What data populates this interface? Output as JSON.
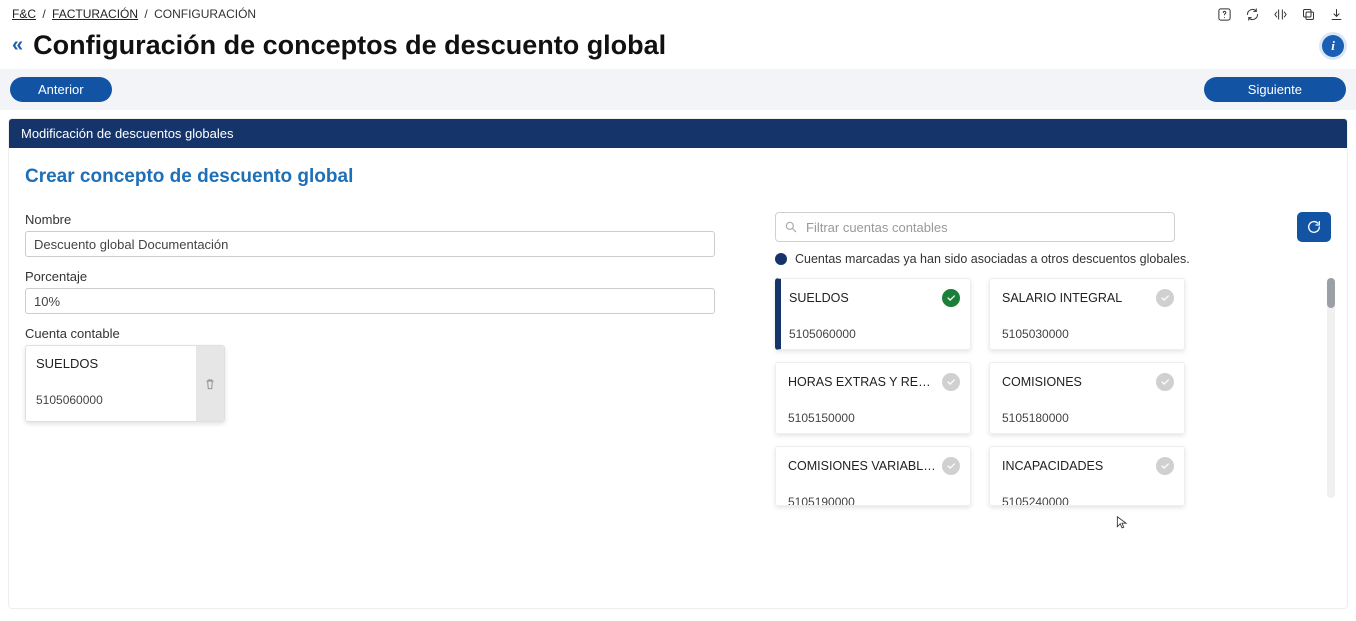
{
  "breadcrumb": {
    "root": "F&C",
    "lvl1": "FACTURACIÓN",
    "lvl2": "CONFIGURACIÓN"
  },
  "page": {
    "title": "Configuración de conceptos de descuento global",
    "prev": "Anterior",
    "next": "Siguiente",
    "panel_header": "Modificación de descuentos globales",
    "section_title": "Crear concepto de descuento global"
  },
  "form": {
    "name_label": "Nombre",
    "name_value": "Descuento global Documentación",
    "pct_label": "Porcentaje",
    "pct_value": "10%",
    "account_label": "Cuenta contable"
  },
  "selected_account": {
    "name": "SUELDOS",
    "code": "5105060000"
  },
  "search": {
    "placeholder": "Filtrar cuentas contables"
  },
  "note": "Cuentas marcadas ya han sido asociadas a otros descuentos globales.",
  "accounts": [
    {
      "name": "SUELDOS",
      "code": "5105060000",
      "selected": true
    },
    {
      "name": "SALARIO INTEGRAL",
      "code": "5105030000",
      "selected": false
    },
    {
      "name": "HORAS EXTRAS Y RECARGO",
      "code": "5105150000",
      "selected": false
    },
    {
      "name": "COMISIONES",
      "code": "5105180000",
      "selected": false
    },
    {
      "name": "COMISIONES VARIABLES",
      "code": "5105190000",
      "selected": false
    },
    {
      "name": "INCAPACIDADES",
      "code": "5105240000",
      "selected": false
    }
  ]
}
